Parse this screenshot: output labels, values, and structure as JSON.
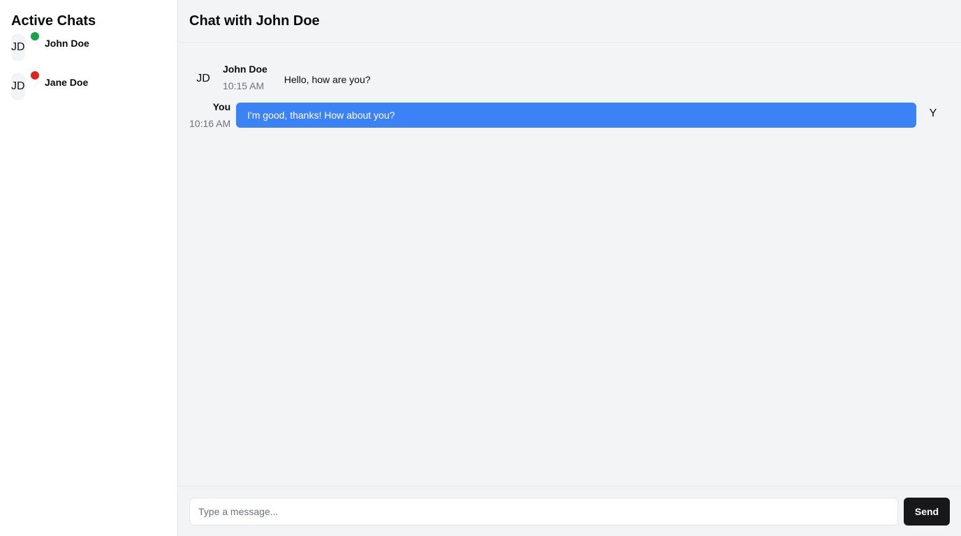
{
  "sidebar": {
    "title": "Active Chats",
    "chats": [
      {
        "initials": "JD",
        "name": "John Doe",
        "status": "online",
        "status_color": "#16a34a"
      },
      {
        "initials": "JD",
        "name": "Jane Doe",
        "status": "offline",
        "status_color": "#dc2626"
      }
    ]
  },
  "header": {
    "title": "Chat with John Doe"
  },
  "messages": [
    {
      "direction": "incoming",
      "avatar": "JD",
      "sender": "John Doe",
      "time": "10:15 AM",
      "text": "Hello, how are you?"
    },
    {
      "direction": "outgoing",
      "avatar": "Y",
      "sender": "You",
      "time": "10:16 AM",
      "text": "I'm good, thanks! How about you?"
    }
  ],
  "composer": {
    "placeholder": "Type a message...",
    "value": "",
    "send_label": "Send"
  },
  "colors": {
    "outgoing_bubble": "#3b82f6",
    "send_button": "#18181b",
    "online": "#16a34a",
    "offline": "#dc2626"
  }
}
